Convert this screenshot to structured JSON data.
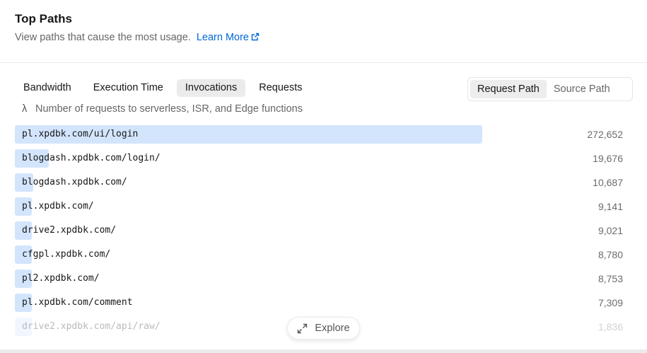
{
  "header": {
    "title": "Top Paths",
    "subtitle": "View paths that cause the most usage.",
    "learn_more": "Learn More"
  },
  "tabs": [
    {
      "label": "Bandwidth",
      "active": false
    },
    {
      "label": "Execution Time",
      "active": false
    },
    {
      "label": "Invocations",
      "active": true
    },
    {
      "label": "Requests",
      "active": false
    }
  ],
  "path_toggle": {
    "options": [
      "Request Path",
      "Source Path"
    ],
    "selected": "Request Path"
  },
  "description": {
    "symbol": "λ",
    "text": "Number of requests to serverless, ISR, and Edge functions"
  },
  "rows": [
    {
      "path": "pl.xpdbk.com/ui/login",
      "value": "272,652",
      "count": 272652
    },
    {
      "path": "blogdash.xpdbk.com/login/",
      "value": "19,676",
      "count": 19676
    },
    {
      "path": "blogdash.xpdbk.com/",
      "value": "10,687",
      "count": 10687
    },
    {
      "path": "pl.xpdbk.com/",
      "value": "9,141",
      "count": 9141
    },
    {
      "path": "drive2.xpdbk.com/",
      "value": "9,021",
      "count": 9021
    },
    {
      "path": "cfgpl.xpdbk.com/",
      "value": "8,780",
      "count": 8780
    },
    {
      "path": "pl2.xpdbk.com/",
      "value": "8,753",
      "count": 8753
    },
    {
      "path": "pl.xpdbk.com/comment",
      "value": "7,309",
      "count": 7309
    },
    {
      "path": "drive2.xpdbk.com/api/raw/",
      "value": "1,836",
      "count": 1836
    }
  ],
  "explore_label": "Explore",
  "colors": {
    "bar": "#d3e5fd",
    "link": "#0068d6"
  }
}
